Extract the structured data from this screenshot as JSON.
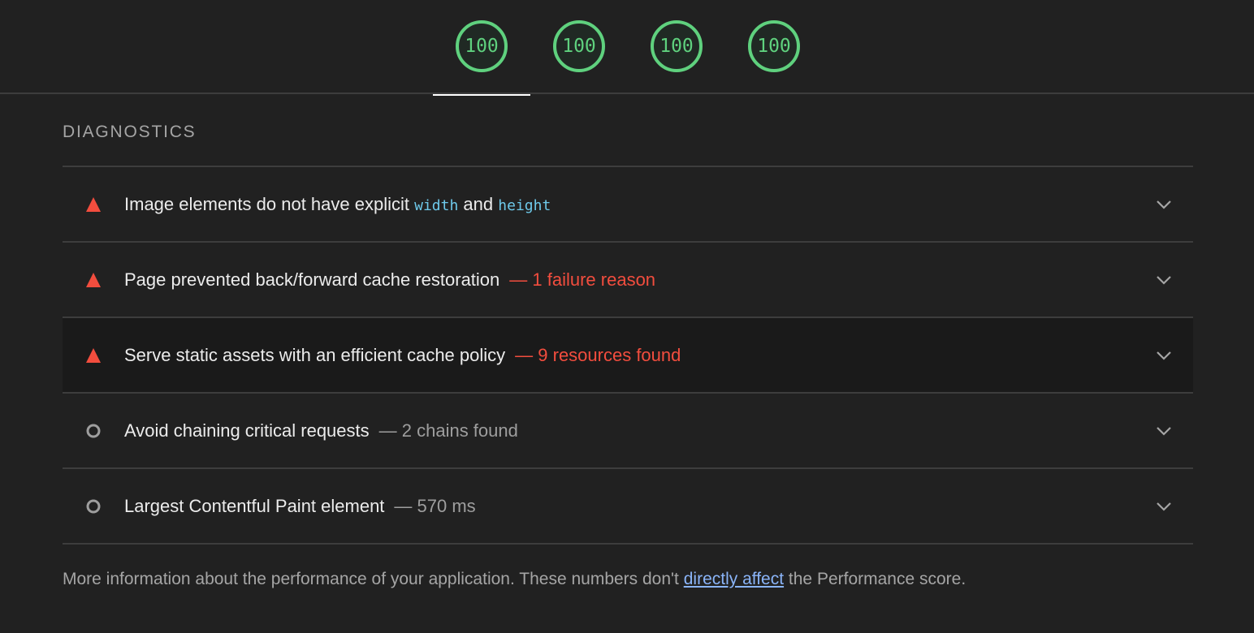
{
  "scores": [
    {
      "label": "100",
      "value": 100,
      "active": true
    },
    {
      "label": "100",
      "value": 100,
      "active": false
    },
    {
      "label": "100",
      "value": 100,
      "active": false
    },
    {
      "label": "100",
      "value": 100,
      "active": false
    }
  ],
  "diagnostics": {
    "title": "DIAGNOSTICS",
    "audits": [
      {
        "status": "fail",
        "icon": "warning-triangle-icon",
        "title_prefix": "Image elements do not have explicit",
        "code1": "width",
        "joiner": "and",
        "code2": "height",
        "extra": ""
      },
      {
        "status": "fail",
        "icon": "warning-triangle-icon",
        "title": "Page prevented back/forward cache restoration",
        "extra": "— 1 failure reason"
      },
      {
        "status": "fail",
        "icon": "warning-triangle-icon",
        "title": "Serve static assets with an efficient cache policy",
        "extra": "— 9 resources found"
      },
      {
        "status": "info",
        "icon": "info-circle-icon",
        "title": "Avoid chaining critical requests",
        "extra": "— 2 chains found"
      },
      {
        "status": "info",
        "icon": "info-circle-icon",
        "title": "Largest Contentful Paint element",
        "extra": "— 570 ms"
      }
    ]
  },
  "footer": {
    "before": "More information about the performance of your application. These numbers don't",
    "link": "directly affect",
    "after": "the Performance score."
  },
  "colors": {
    "pass": "#5fd17e",
    "fail": "#f24d3e",
    "info_icon": "#9e9e9e",
    "code": "#6ec9ea",
    "link": "#8ab4f8",
    "background": "#212121"
  }
}
